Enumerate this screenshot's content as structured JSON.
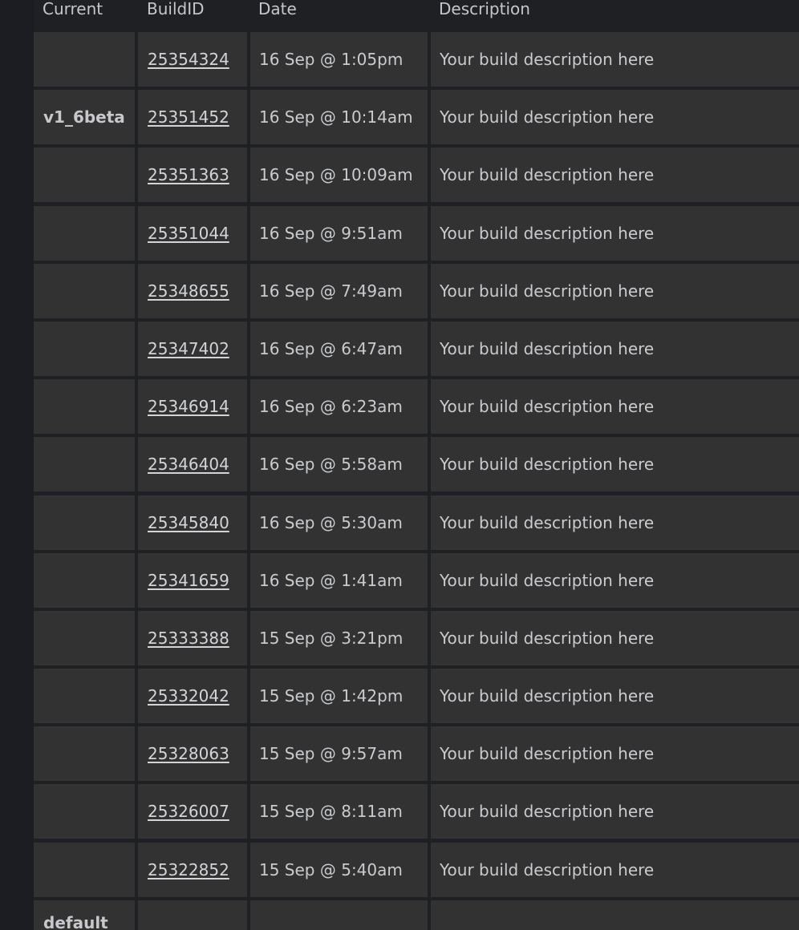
{
  "headers": {
    "current": "Current",
    "build_id": "BuildID",
    "date": "Date",
    "description": "Description"
  },
  "builds": [
    {
      "branch": "",
      "build_id": "25354324",
      "date": "16 Sep @ 1:05pm",
      "description": "Your build description here"
    },
    {
      "branch": "v1_6beta",
      "build_id": "25351452",
      "date": "16 Sep @ 10:14am",
      "description": "Your build description here"
    },
    {
      "branch": "",
      "build_id": "25351363",
      "date": "16 Sep @ 10:09am",
      "description": "Your build description here"
    },
    {
      "branch": "",
      "build_id": "25351044",
      "date": "16 Sep @ 9:51am",
      "description": "Your build description here"
    },
    {
      "branch": "",
      "build_id": "25348655",
      "date": "16 Sep @ 7:49am",
      "description": "Your build description here"
    },
    {
      "branch": "",
      "build_id": "25347402",
      "date": "16 Sep @ 6:47am",
      "description": "Your build description here"
    },
    {
      "branch": "",
      "build_id": "25346914",
      "date": "16 Sep @ 6:23am",
      "description": "Your build description here"
    },
    {
      "branch": "",
      "build_id": "25346404",
      "date": "16 Sep @ 5:58am",
      "description": "Your build description here"
    },
    {
      "branch": "",
      "build_id": "25345840",
      "date": "16 Sep @ 5:30am",
      "description": "Your build description here"
    },
    {
      "branch": "",
      "build_id": "25341659",
      "date": "16 Sep @ 1:41am",
      "description": "Your build description here"
    },
    {
      "branch": "",
      "build_id": "25333388",
      "date": "15 Sep @ 3:21pm",
      "description": "Your build description here"
    },
    {
      "branch": "",
      "build_id": "25332042",
      "date": "15 Sep @ 1:42pm",
      "description": "Your build description here"
    },
    {
      "branch": "",
      "build_id": "25328063",
      "date": "15 Sep @ 9:57am",
      "description": "Your build description here"
    },
    {
      "branch": "",
      "build_id": "25326007",
      "date": "15 Sep @ 8:11am",
      "description": "Your build description here"
    },
    {
      "branch": "",
      "build_id": "25322852",
      "date": "15 Sep @ 5:40am",
      "description": "Your build description here"
    },
    {
      "branch": "default",
      "build_id": "",
      "date": "",
      "description": ""
    }
  ]
}
